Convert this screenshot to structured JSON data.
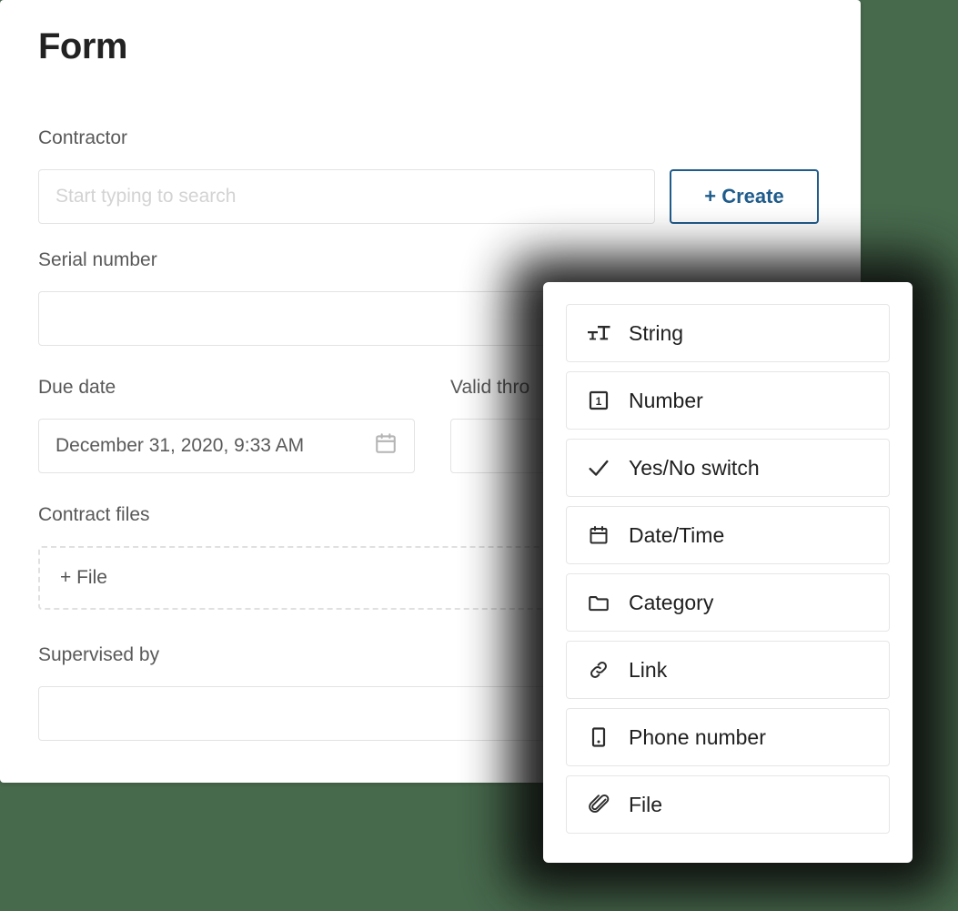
{
  "background_color": "#47694c",
  "form": {
    "title": "Form",
    "accent_color": "#1f5c8b",
    "fields": {
      "contractor": {
        "label": "Contractor",
        "placeholder": "Start typing to search",
        "value": ""
      },
      "create_button": {
        "label": "+ Create"
      },
      "serial_number": {
        "label": "Serial number",
        "value": ""
      },
      "due_date": {
        "label": "Due date",
        "value": "December 31, 2020, 9:33 AM",
        "icon": "calendar-icon"
      },
      "valid_through": {
        "label": "Valid thro",
        "value": ""
      },
      "contract_files": {
        "label": "Contract files",
        "add_label": "+ File"
      },
      "supervised_by": {
        "label": "Supervised by",
        "value": ""
      }
    }
  },
  "type_panel": {
    "items": [
      {
        "label": "String",
        "icon": "text-format-icon"
      },
      {
        "label": "Number",
        "icon": "number-box-icon"
      },
      {
        "label": "Yes/No switch",
        "icon": "checkmark-icon"
      },
      {
        "label": "Date/Time",
        "icon": "calendar-icon"
      },
      {
        "label": "Category",
        "icon": "folder-icon"
      },
      {
        "label": "Link",
        "icon": "link-icon"
      },
      {
        "label": "Phone number",
        "icon": "phone-icon"
      },
      {
        "label": "File",
        "icon": "paperclip-icon"
      }
    ]
  }
}
